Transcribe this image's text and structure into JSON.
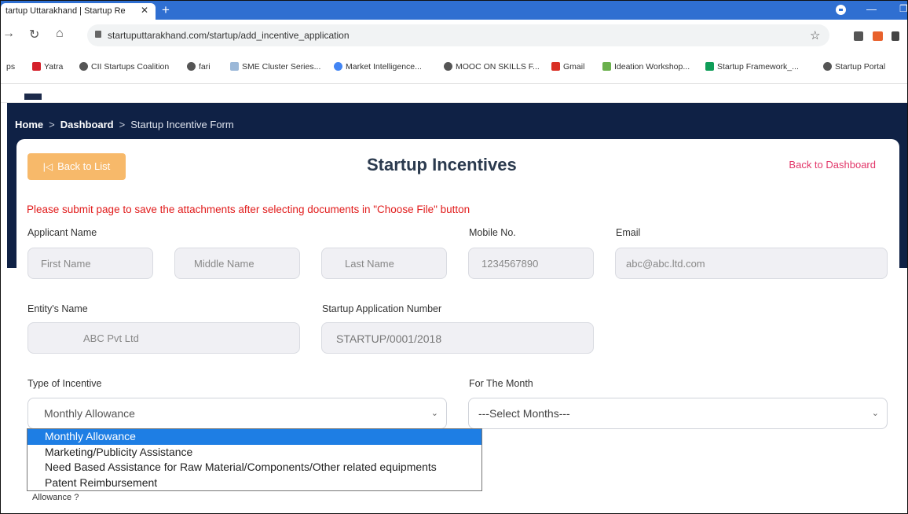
{
  "browser": {
    "tab_title": "tartup Uttarakhand | Startup Re",
    "url": "startuputtarakhand.com/startup/add_incentive_application",
    "bookmarks": [
      {
        "label": "ps",
        "icon": "apps-icon"
      },
      {
        "label": "Yatra",
        "icon": "yatra-icon"
      },
      {
        "label": "CII Startups Coalition",
        "icon": "globe-icon"
      },
      {
        "label": "fari",
        "icon": "globe-icon"
      },
      {
        "label": "SME Cluster Series...",
        "icon": "doc-icon"
      },
      {
        "label": "Market Intelligence...",
        "icon": "google-icon"
      },
      {
        "label": "MOOC ON SKILLS F...",
        "icon": "globe-icon"
      },
      {
        "label": "Gmail",
        "icon": "gmail-icon"
      },
      {
        "label": "Ideation Workshop...",
        "icon": "leaf-icon"
      },
      {
        "label": "Startup Framework_...",
        "icon": "sheets-icon"
      },
      {
        "label": "Startup Portal",
        "icon": "globe-icon"
      }
    ]
  },
  "breadcrumb": {
    "home": "Home",
    "dashboard": "Dashboard",
    "current": "Startup Incentive Form",
    "separator": ">"
  },
  "card": {
    "back_to_list": "Back to List",
    "title": "Startup Incentives",
    "back_to_dashboard": "Back to Dashboard",
    "notice": "Please submit page to save the attachments after selecting documents in \"Choose File\" button"
  },
  "form": {
    "applicant_label": "Applicant Name",
    "mobile_label": "Mobile No.",
    "email_label": "Email",
    "first_name": "First Name",
    "middle_name": "Middle Name",
    "last_name": "Last Name",
    "mobile": "1234567890",
    "email": "abc@abc.ltd.com",
    "entity_label": "Entity's Name",
    "entity": "ABC Pvt Ltd",
    "app_number_label": "Startup Application Number",
    "app_number": "STARTUP/0001/2018",
    "incentive_label": "Type of Incentive",
    "incentive_selected": "Monthly Allowance",
    "month_label": "For The Month",
    "month_selected": "---Select Months---",
    "incentive_options": [
      "Monthly Allowance",
      "Marketing/Publicity Assistance",
      "Need Based Assistance for Raw Material/Components/Other related equipments",
      "Patent Reimbursement"
    ],
    "allowance_text": "Allowance ?"
  },
  "colors": {
    "navy": "#0f2145",
    "back_button": "#f7b96a",
    "notice_red": "#e11b1b",
    "dashboard_link": "#e2376a",
    "option_highlight": "#1e7ee4"
  }
}
